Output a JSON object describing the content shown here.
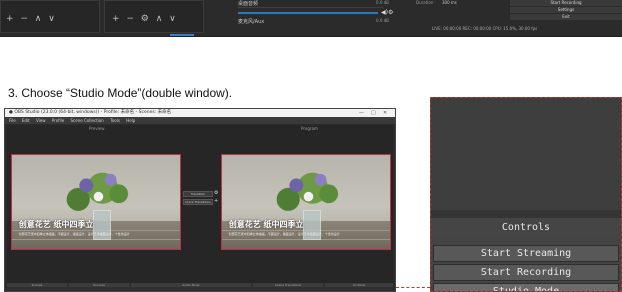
{
  "top_strip": {
    "left_controls": "+ − ∧ ∨",
    "left_controls_2": "+ − ⚙ ∧ ∨",
    "mixer_label_1": "桌面音频",
    "mixer_label_2": "麦克风/Aux",
    "mixer_db_1": "0.0 dB",
    "mixer_db_2": "0.0 dB",
    "transition_label": "Duration",
    "transition_value": "300 ms",
    "status_text": "LIVE: 00:00:00   REC: 00:00:00   CPU: 15.0%, 30.00 fps",
    "buttons": [
      "Start Recording",
      "Settings",
      "Exit"
    ]
  },
  "caption": "3. Choose “Studio Mode”(double window).",
  "obs_window": {
    "title": "OBS Studio (23.0.0 (64-bit, windows)) - Profile: 未命名 - Scenes: 未命名",
    "menu": [
      "File",
      "Edit",
      "View",
      "Profile",
      "Scene Collection",
      "Tools",
      "Help"
    ],
    "preview_label": "Preview",
    "program_label": "Program",
    "overlay_title": "创意花艺 纸中四季立",
    "overlay_sub": "创意花艺纸中四季立体插画，平面设计，插画设计，设计艺术插图设计，个性化设计",
    "transition_button": "Transition",
    "quick_transitions": "Quick Transitions",
    "docks": [
      "Scenes",
      "Sources",
      "Audio Mixer",
      "Scene Transitions",
      "Controls"
    ],
    "window_controls": [
      "—",
      "□",
      "✕"
    ]
  },
  "zoom_panel": {
    "controls_header": "Controls",
    "buttons": [
      "Start Streaming",
      "Start Recording",
      "Studio Mode"
    ]
  }
}
